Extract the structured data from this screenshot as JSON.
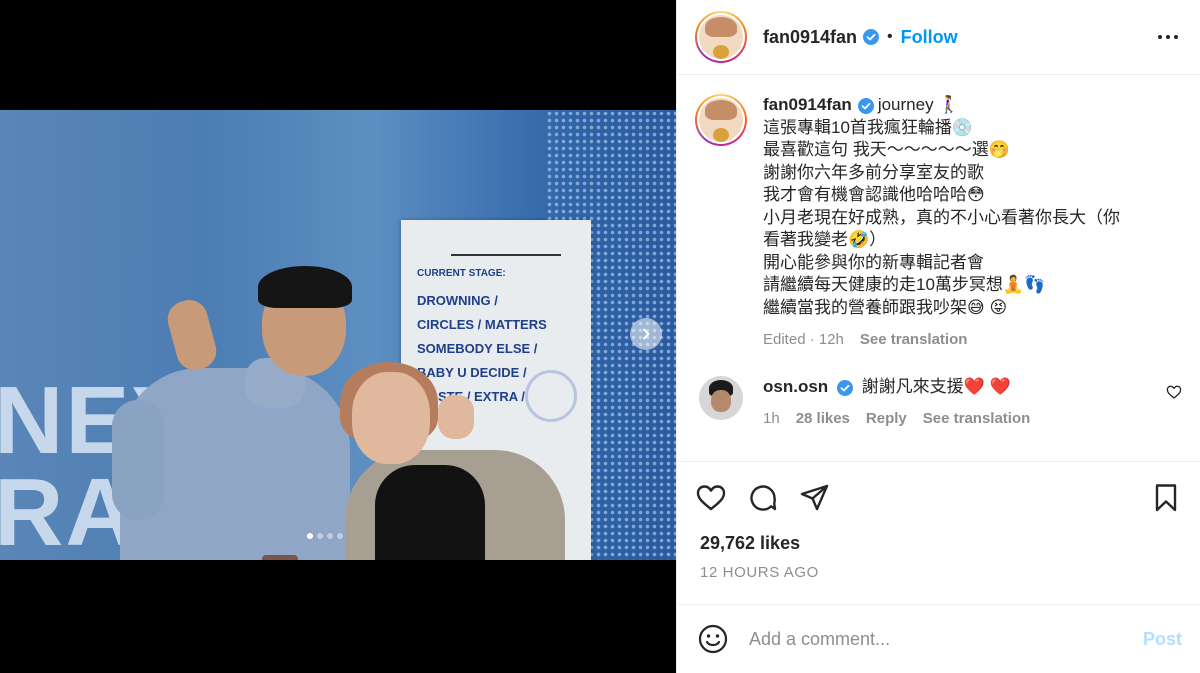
{
  "header": {
    "username": "fan0914fan",
    "separator": "•",
    "follow_label": "Follow"
  },
  "media": {
    "wall_text": [
      "NEY",
      "RAP"
    ],
    "poster_lines": [
      "CURRENT STAGE:",
      "DROWNING  /",
      "CIRCLES  /  MATTERS",
      "SOMEBODY ELSE  /",
      "BABY U DECIDE  /",
      "WASTE  /  EXTRA  /"
    ],
    "slide_count": 4,
    "active_slide": 1
  },
  "caption": {
    "username": "fan0914fan",
    "lines": [
      "journey 🚶‍♀️",
      "這張專輯10首我瘋狂輪播💿",
      "最喜歡這句 我天～～～～～選🤭",
      "謝謝你六年多前分享室友的歌",
      "我才會有機會認識他哈哈哈😳",
      "小月老現在好成熟，真的不小心看著你長大（你",
      "看著我變老🤣）",
      "開心能參與你的新專輯記者會",
      "請繼續每天健康的走10萬步冥想🧘👣",
      "繼續當我的營養師跟我吵架😅 😝"
    ],
    "edited": "Edited · 12h",
    "see_translation": "See translation"
  },
  "comment": {
    "username": "osn.osn",
    "text": "謝謝凡來支援❤️ ❤️",
    "time": "1h",
    "likes": "28 likes",
    "reply": "Reply",
    "see_translation": "See translation"
  },
  "stats": {
    "likes": "29,762 likes",
    "time": "12 HOURS AGO"
  },
  "add_comment": {
    "placeholder": "Add a comment...",
    "post_label": "Post"
  },
  "colors": {
    "accent": "#0095f6",
    "post_disabled": "#b2dffc",
    "muted": "#8e8e8e",
    "text": "#262626"
  }
}
